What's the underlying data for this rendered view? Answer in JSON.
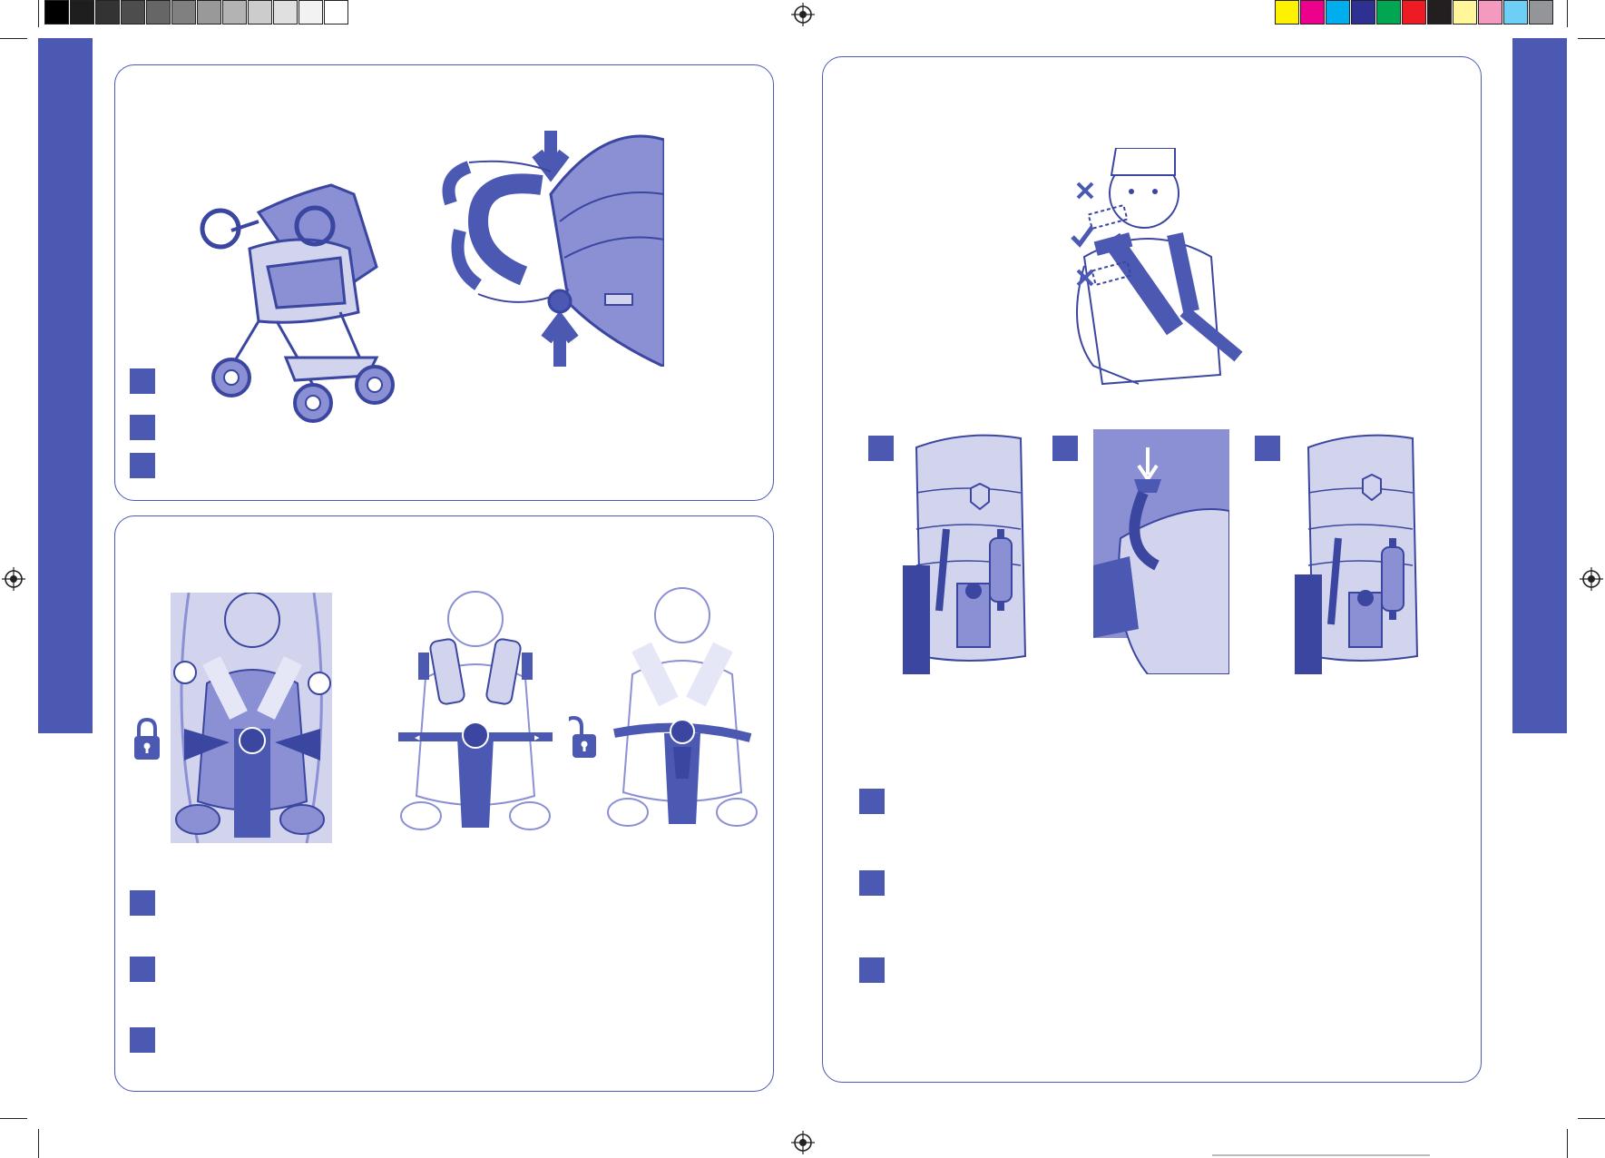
{
  "colors": {
    "accent": "#4b59b3",
    "accent_light": "#8a90d3",
    "accent_pale": "#d2d4ee",
    "line": "#3a46a0"
  },
  "gray_swatches": [
    "#000000",
    "#1e1e1e",
    "#333333",
    "#4d4d4d",
    "#666666",
    "#808080",
    "#999999",
    "#b3b3b3",
    "#cccccc",
    "#e0e0e0",
    "#f2f2f2",
    "#ffffff"
  ],
  "color_swatches": [
    "#fff200",
    "#ec008c",
    "#00aeef",
    "#2e3192",
    "#00a651",
    "#ed1c24",
    "#231f20",
    "#fff799",
    "#f49ac1",
    "#6dcff6",
    "#939598"
  ],
  "icons": {
    "lock": "padlock-closed-icon",
    "unlock": "padlock-open-icon",
    "correct": "check-mark-icon",
    "wrong": "cross-mark-icon",
    "registration": "registration-mark-icon"
  }
}
